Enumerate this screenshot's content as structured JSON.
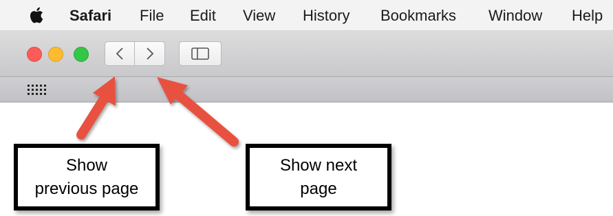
{
  "menubar": {
    "app_name": "Safari",
    "items": [
      "File",
      "Edit",
      "View",
      "History",
      "Bookmarks",
      "Window",
      "Help"
    ]
  },
  "colors": {
    "close": "#fc5b57",
    "minimize": "#fdbc2e",
    "zoom": "#33c748",
    "arrow": "#e8513f"
  },
  "toolbar": {
    "back_icon": "chevron-left-icon",
    "forward_icon": "chevron-right-icon",
    "sidebar_icon": "sidebar-icon"
  },
  "favorites": {
    "icon": "grid-icon"
  },
  "callouts": {
    "previous": {
      "line1": "Show",
      "line2": "previous page"
    },
    "next": {
      "line1": "Show next",
      "line2": "page"
    }
  }
}
